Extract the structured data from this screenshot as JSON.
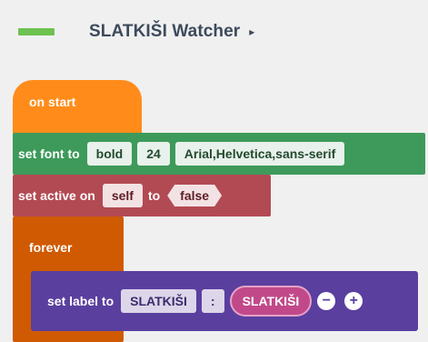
{
  "header": {
    "title": "SLATKIŠI Watcher",
    "caret": "▸",
    "swatch_color": "#6dc251"
  },
  "blocks": {
    "on_start": {
      "label": "on start",
      "color": "#ff8c1a"
    },
    "set_font": {
      "label": "set font to",
      "weight": "bold",
      "size": "24",
      "family": "Arial,Helvetica,sans-serif",
      "color": "#3d9a5a"
    },
    "set_active": {
      "label": "set active on",
      "target": "self",
      "to_label": "to",
      "value": "false",
      "color": "#b24a53"
    },
    "forever": {
      "label": "forever",
      "color": "#cf5a02"
    },
    "set_label": {
      "label": "set label to",
      "text_field": "SLATKIŠI",
      "separator": ":",
      "variable": "SLATKIŠI",
      "minus_icon": "−",
      "plus_icon": "+",
      "color": "#5a3f9f"
    }
  }
}
